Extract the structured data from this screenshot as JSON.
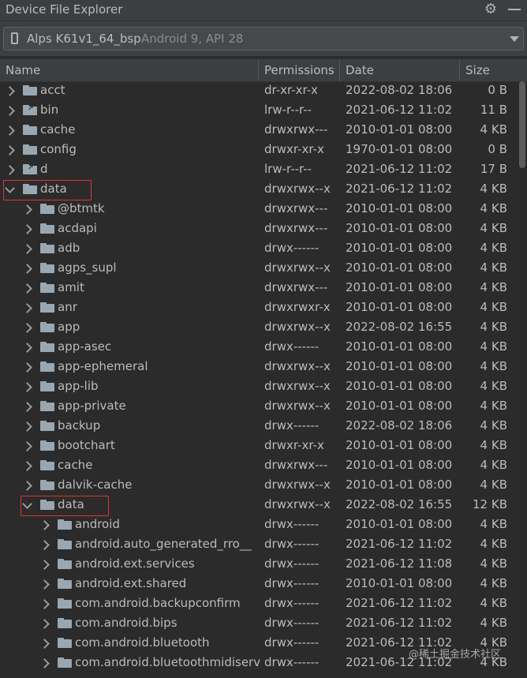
{
  "window": {
    "title": "Device File Explorer",
    "settings_icon": "gear-icon",
    "minimize_icon": "minimize-icon"
  },
  "device_selector": {
    "device_name": "Alps K61v1_64_bsp",
    "device_info": "Android 9, API 28",
    "icon": "phone-icon"
  },
  "columns": {
    "name": "Name",
    "permissions": "Permissions",
    "date": "Date",
    "size": "Size"
  },
  "rows": [
    {
      "name": "acct",
      "perm": "dr-xr-xr-x",
      "date": "2022-08-02 18:06",
      "size": "0 B",
      "level": 0,
      "expanded": false,
      "link": false
    },
    {
      "name": "bin",
      "perm": "lrw-r--r--",
      "date": "2021-06-12 11:02",
      "size": "11 B",
      "level": 0,
      "expanded": false,
      "link": true
    },
    {
      "name": "cache",
      "perm": "drwxrwx---",
      "date": "2010-01-01 08:00",
      "size": "4 KB",
      "level": 0,
      "expanded": false,
      "link": false
    },
    {
      "name": "config",
      "perm": "drwxr-xr-x",
      "date": "1970-01-01 08:00",
      "size": "0 B",
      "level": 0,
      "expanded": false,
      "link": false
    },
    {
      "name": "d",
      "perm": "lrw-r--r--",
      "date": "2021-06-12 11:02",
      "size": "17 B",
      "level": 0,
      "expanded": false,
      "link": true
    },
    {
      "name": "data",
      "perm": "drwxrwx--x",
      "date": "2021-06-12 11:02",
      "size": "4 KB",
      "level": 0,
      "expanded": true,
      "link": false,
      "highlight": true
    },
    {
      "name": "@btmtk",
      "perm": "drwxrwx---",
      "date": "2010-01-01 08:00",
      "size": "4 KB",
      "level": 1,
      "expanded": false,
      "link": false
    },
    {
      "name": "acdapi",
      "perm": "drwxrwx---",
      "date": "2010-01-01 08:00",
      "size": "4 KB",
      "level": 1,
      "expanded": false,
      "link": false
    },
    {
      "name": "adb",
      "perm": "drwx------",
      "date": "2010-01-01 08:00",
      "size": "4 KB",
      "level": 1,
      "expanded": false,
      "link": false
    },
    {
      "name": "agps_supl",
      "perm": "drwxrwx--x",
      "date": "2010-01-01 08:00",
      "size": "4 KB",
      "level": 1,
      "expanded": false,
      "link": false
    },
    {
      "name": "amit",
      "perm": "drwxrwx---",
      "date": "2010-01-01 08:00",
      "size": "4 KB",
      "level": 1,
      "expanded": false,
      "link": false
    },
    {
      "name": "anr",
      "perm": "drwxrwxr-x",
      "date": "2010-01-01 08:00",
      "size": "4 KB",
      "level": 1,
      "expanded": false,
      "link": false
    },
    {
      "name": "app",
      "perm": "drwxrwx--x",
      "date": "2022-08-02 16:55",
      "size": "4 KB",
      "level": 1,
      "expanded": false,
      "link": false
    },
    {
      "name": "app-asec",
      "perm": "drwx------",
      "date": "2010-01-01 08:00",
      "size": "4 KB",
      "level": 1,
      "expanded": false,
      "link": false
    },
    {
      "name": "app-ephemeral",
      "perm": "drwxrwx--x",
      "date": "2010-01-01 08:00",
      "size": "4 KB",
      "level": 1,
      "expanded": false,
      "link": false
    },
    {
      "name": "app-lib",
      "perm": "drwxrwx--x",
      "date": "2010-01-01 08:00",
      "size": "4 KB",
      "level": 1,
      "expanded": false,
      "link": false
    },
    {
      "name": "app-private",
      "perm": "drwxrwx--x",
      "date": "2010-01-01 08:00",
      "size": "4 KB",
      "level": 1,
      "expanded": false,
      "link": false
    },
    {
      "name": "backup",
      "perm": "drwx------",
      "date": "2022-08-02 18:06",
      "size": "4 KB",
      "level": 1,
      "expanded": false,
      "link": false
    },
    {
      "name": "bootchart",
      "perm": "drwxr-xr-x",
      "date": "2010-01-01 08:00",
      "size": "4 KB",
      "level": 1,
      "expanded": false,
      "link": false
    },
    {
      "name": "cache",
      "perm": "drwxrwx---",
      "date": "2010-01-01 08:00",
      "size": "4 KB",
      "level": 1,
      "expanded": false,
      "link": false
    },
    {
      "name": "dalvik-cache",
      "perm": "drwxrwx--x",
      "date": "2010-01-01 08:00",
      "size": "4 KB",
      "level": 1,
      "expanded": false,
      "link": false
    },
    {
      "name": "data",
      "perm": "drwxrwx--x",
      "date": "2022-08-02 16:55",
      "size": "12 KB",
      "level": 1,
      "expanded": true,
      "link": false,
      "highlight": true
    },
    {
      "name": "android",
      "perm": "drwx------",
      "date": "2010-01-01 08:00",
      "size": "4 KB",
      "level": 2,
      "expanded": false,
      "link": false
    },
    {
      "name": "android.auto_generated_rro__",
      "perm": "drwx------",
      "date": "2021-06-12 11:02",
      "size": "4 KB",
      "level": 2,
      "expanded": false,
      "link": false
    },
    {
      "name": "android.ext.services",
      "perm": "drwx------",
      "date": "2021-06-12 11:08",
      "size": "4 KB",
      "level": 2,
      "expanded": false,
      "link": false
    },
    {
      "name": "android.ext.shared",
      "perm": "drwx------",
      "date": "2010-01-01 08:00",
      "size": "4 KB",
      "level": 2,
      "expanded": false,
      "link": false
    },
    {
      "name": "com.android.backupconfirm",
      "perm": "drwx------",
      "date": "2021-06-12 11:02",
      "size": "4 KB",
      "level": 2,
      "expanded": false,
      "link": false
    },
    {
      "name": "com.android.bips",
      "perm": "drwx------",
      "date": "2021-06-12 11:02",
      "size": "4 KB",
      "level": 2,
      "expanded": false,
      "link": false
    },
    {
      "name": "com.android.bluetooth",
      "perm": "drwx------",
      "date": "2021-06-12 11:02",
      "size": "4 KB",
      "level": 2,
      "expanded": false,
      "link": false
    },
    {
      "name": "com.android.bluetoothmidiserv",
      "perm": "drwx------",
      "date": "2021-06-12 11:02",
      "size": "4 KB",
      "level": 2,
      "expanded": false,
      "link": false
    }
  ],
  "watermark": "@稀土掘金技术社区",
  "colors": {
    "background": "#2b2b2b",
    "panel": "#3c3f41",
    "text": "#bbbbbb",
    "folder": "#9aa7b0",
    "highlight": "#e0332f"
  }
}
